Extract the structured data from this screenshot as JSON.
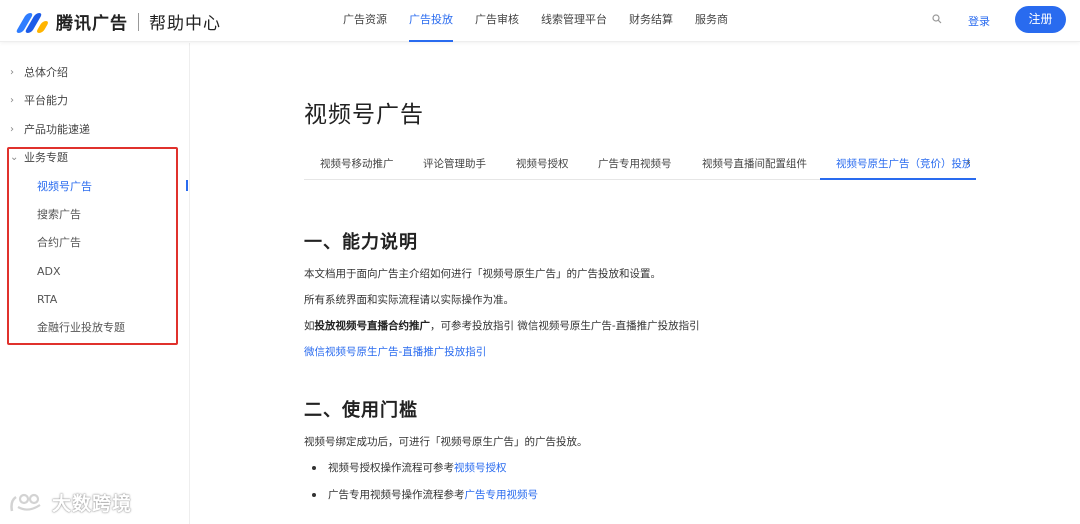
{
  "header": {
    "brand": "腾讯广告",
    "brand_sub": "帮助中心",
    "nav": [
      "广告资源",
      "广告投放",
      "广告审核",
      "线索管理平台",
      "财务结算",
      "服务商"
    ],
    "nav_active_index": 1,
    "login": "登录",
    "register": "注册",
    "accent_color": "#296bef"
  },
  "sidebar": {
    "top_items": [
      "总体介绍",
      "平台能力",
      "产品功能速递"
    ],
    "open_group": "业务专题",
    "sub_items": [
      "视频号广告",
      "搜索广告",
      "合约广告",
      "ADX",
      "RTA",
      "金融行业投放专题"
    ],
    "active_sub_index": 0,
    "highlight_color": "#e0312c"
  },
  "main": {
    "title": "视频号广告",
    "tabs": [
      "视频号移动推广",
      "评论管理助手",
      "视频号授权",
      "广告专用视频号",
      "视频号直播间配置组件",
      "视频号原生广告（竞价）投放"
    ],
    "active_tab_index": 5,
    "section1": {
      "heading": "一、能力说明",
      "p1": "本文档用于面向广告主介绍如何进行「视频号原生广告」的广告投放和设置。",
      "p2": "所有系统界面和实际流程请以实际操作为准。",
      "p3_prefix": "如",
      "p3_bold": "投放视频号直播合约推广",
      "p3_suffix": "，可参考投放指引 微信视频号原生广告-直播推广投放指引",
      "link": "微信视频号原生广告-直播推广投放指引"
    },
    "section2": {
      "heading": "二、使用门槛",
      "p1": "视频号绑定成功后，可进行「视频号原生广告」的广告投放。",
      "bullet1_text": "视频号授权操作流程可参考",
      "bullet1_link": "视频号授权",
      "bullet2_text": "广告专用视频号操作流程参考",
      "bullet2_link": "广告专用视频号"
    }
  },
  "watermark": {
    "text": "大数跨境"
  }
}
